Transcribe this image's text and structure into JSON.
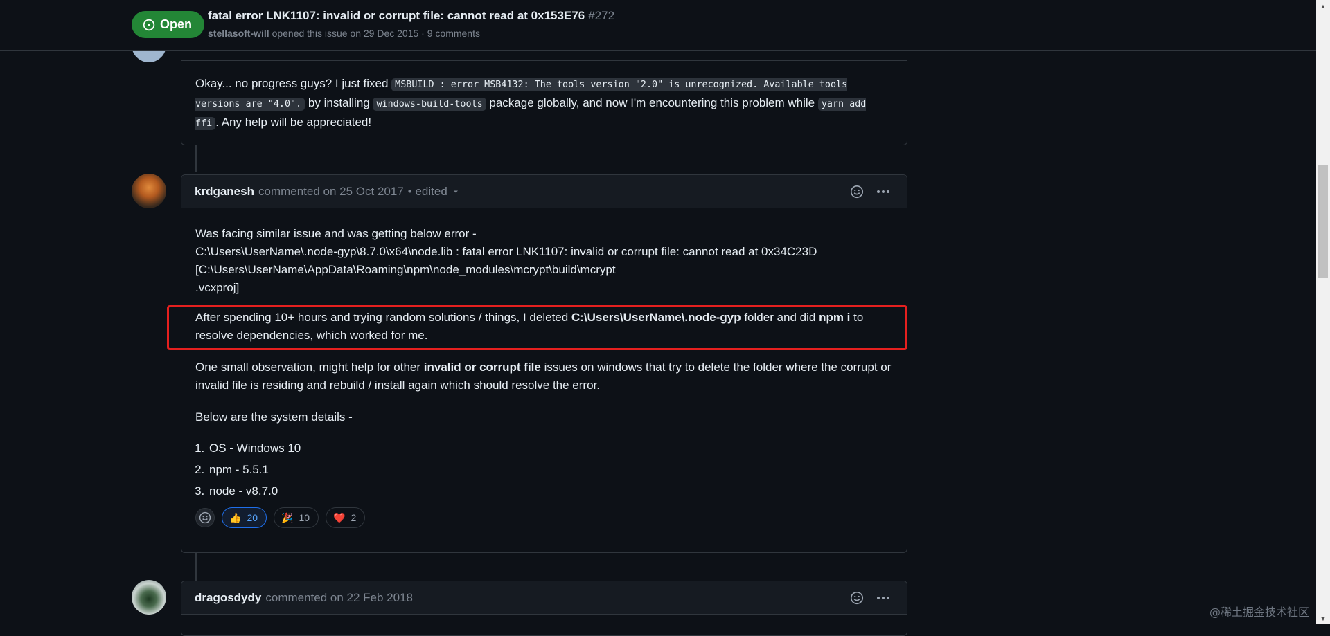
{
  "issue": {
    "state": "Open",
    "title": "fatal error LNK1107: invalid or corrupt file: cannot read at 0x153E76",
    "number": "#272",
    "author": "stellasoft-will",
    "meta_rest": " opened this issue on 29 Dec 2015 · 9 comments"
  },
  "comment1": {
    "text_1": "Okay... no progress guys? I just fixed ",
    "code_1": "MSBUILD : error MSB4132: The tools version \"2.0\" is unrecognized. Available tools versions are \"4.0\".",
    "text_2": " by installing ",
    "code_2": "windows-build-tools",
    "text_3": " package globally, and now I'm encountering this problem while ",
    "code_3": "yarn add ffi",
    "text_4": ". Any help will be appreciated!"
  },
  "comment2": {
    "author": "krdganesh",
    "commented_on": "commented on 25 Oct 2017",
    "edited": "• edited",
    "error_intro": "Was facing similar issue and was getting below error -",
    "error_line_1": "C:\\Users\\UserName\\.node-gyp\\8.7.0\\x64\\node.lib : fatal error LNK1107: invalid or corrupt file: cannot read at 0x34C23D",
    "error_line_2": "[C:\\Users\\UserName\\AppData\\Roaming\\npm\\node_modules\\mcrypt\\build\\mcrypt",
    "error_line_3": ".vcxproj]",
    "solution_1": "After spending 10+ hours and trying random solutions / things, I deleted ",
    "solution_bold_1": "C:\\Users\\UserName\\.node-gyp",
    "solution_2": " folder and did ",
    "solution_bold_2": "npm i",
    "solution_3": " to resolve dependencies, which worked for me.",
    "observation_1": "One small observation, might help for other ",
    "observation_bold": "invalid or corrupt file",
    "observation_2": " issues on windows that try to delete the folder where the corrupt or invalid file is residing and rebuild / install again which should resolve the error.",
    "details_intro": "Below are the system details -",
    "details": [
      "OS - Windows 10",
      "npm - 5.5.1",
      "node - v8.7.0"
    ],
    "reactions": [
      {
        "emoji": "👍",
        "count": "20",
        "active": true
      },
      {
        "emoji": "🎉",
        "count": "10",
        "active": false
      },
      {
        "emoji": "❤️",
        "count": "2",
        "active": false
      }
    ]
  },
  "comment3": {
    "author": "dragosdydy",
    "commented_on": "commented on 22 Feb 2018"
  },
  "watermark": "@稀土掘金技术社区",
  "colors": {
    "background": "#0d1117",
    "header_bg": "#161b22",
    "border": "#30363d",
    "open_badge": "#238636",
    "highlight": "#e5201f",
    "active_reaction": "#1f6feb"
  }
}
